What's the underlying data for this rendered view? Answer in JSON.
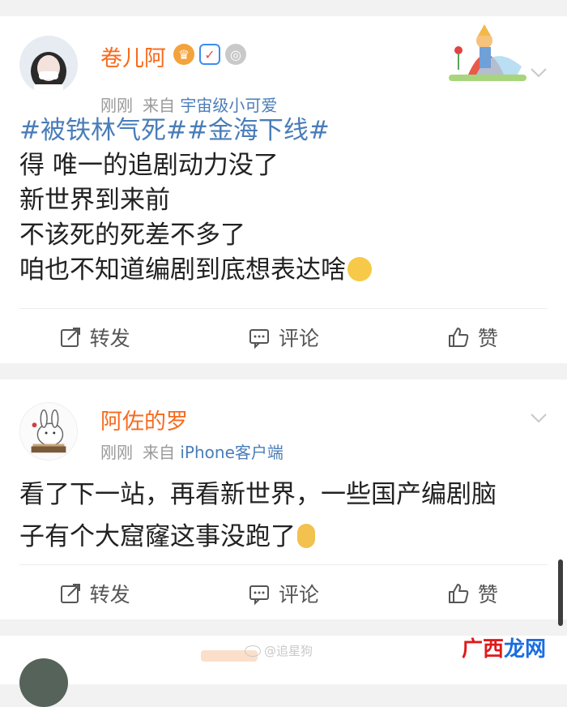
{
  "posts": [
    {
      "username": "卷儿阿",
      "time": "刚刚",
      "source_prefix": "来自",
      "source": "宇宙级小可爱",
      "hashtag": "#被铁林气死##金海下线#",
      "lines": [
        "得 唯一的追剧动力没了",
        "新世界到来前",
        "不该死的死差不多了",
        "咱也不知道编剧到底想表达啥"
      ],
      "actions": {
        "repost": "转发",
        "comment": "评论",
        "like": "赞"
      }
    },
    {
      "username": "阿佐的罗",
      "time": "刚刚",
      "source_prefix": "来自",
      "source": "iPhone客户端",
      "lines": [
        "看了下一站，再看新世界，一些国产编剧脑",
        "子有个大窟窿这事没跑了"
      ],
      "actions": {
        "repost": "转发",
        "comment": "评论",
        "like": "赞"
      }
    }
  ],
  "watermark": "@追星狗",
  "site_logo": {
    "part1": "广西",
    "part2": "龙网"
  },
  "colors": {
    "username": "#f86a1c",
    "link": "#4a7db8",
    "logo_red": "#e01a1a",
    "logo_blue": "#1a6de0"
  },
  "icons": [
    "repost-icon",
    "comment-icon",
    "like-icon",
    "chevron-down-icon",
    "vip-crown-icon",
    "verified-icon",
    "medal-icon",
    "grinning-emoji",
    "crying-emoji"
  ]
}
